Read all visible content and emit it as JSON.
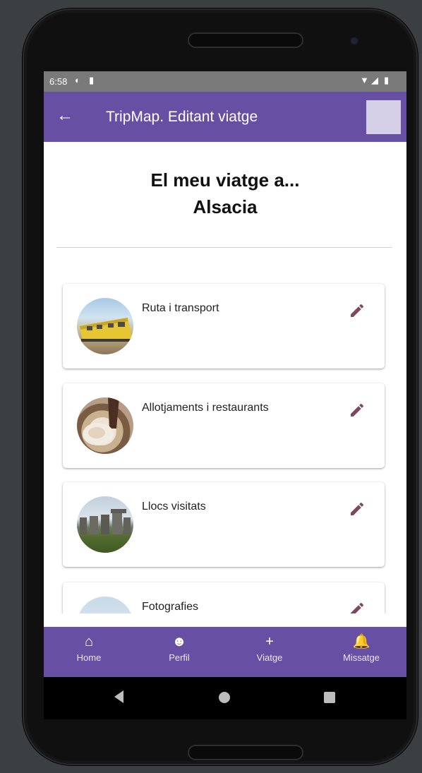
{
  "status_bar": {
    "time": "6:58"
  },
  "app_bar": {
    "title": "TripMap. Editant viatge"
  },
  "trip": {
    "heading_line1": "El meu viatge a...",
    "heading_line2": "Alsacia"
  },
  "sections": [
    {
      "label": "Ruta i transport",
      "image": "train-photo"
    },
    {
      "label": "Allotjaments i restaurants",
      "image": "food-photo"
    },
    {
      "label": "Llocs visitats",
      "image": "stonehenge-photo"
    },
    {
      "label": "Fotografies",
      "image": "sky-photo"
    }
  ],
  "bottom_nav": [
    {
      "label": "Home",
      "icon": "home-icon"
    },
    {
      "label": "Perfil",
      "icon": "face-icon"
    },
    {
      "label": "Viatge",
      "icon": "plus-icon"
    },
    {
      "label": "Missatge",
      "icon": "bell-icon"
    }
  ],
  "colors": {
    "primary": "#6750a4",
    "edit_icon": "#7b4a5e",
    "status_bar": "#7a7a7a"
  }
}
